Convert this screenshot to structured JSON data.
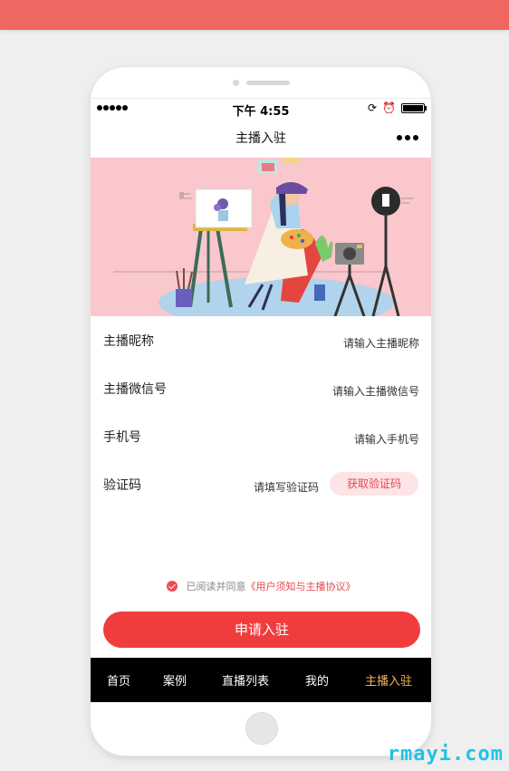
{
  "status_bar": {
    "time": "下午 4:55"
  },
  "nav": {
    "title": "主播入驻"
  },
  "form": {
    "nickname": {
      "label": "主播昵称",
      "placeholder": "请输入主播昵称"
    },
    "wechat": {
      "label": "主播微信号",
      "placeholder": "请输入主播微信号"
    },
    "phone": {
      "label": "手机号",
      "placeholder": "请输入手机号"
    },
    "code": {
      "label": "验证码",
      "placeholder": "请填写验证码",
      "button": "获取验证码"
    }
  },
  "agreement": {
    "text": "已阅读并同意",
    "link": "《用户须知与主播协议》",
    "checked": true
  },
  "submit": {
    "label": "申请入驻"
  },
  "tabbar": {
    "items": [
      {
        "label": "首页"
      },
      {
        "label": "案例"
      },
      {
        "label": "直播列表"
      },
      {
        "label": "我的"
      },
      {
        "label": "主播入驻"
      }
    ],
    "active_index": 4
  },
  "watermark": "rmayi.com",
  "colors": {
    "primary": "#f13c3e",
    "active_tab": "#f4b45a",
    "banner_bg": "#f9c7cc",
    "top_band": "#f06660"
  }
}
